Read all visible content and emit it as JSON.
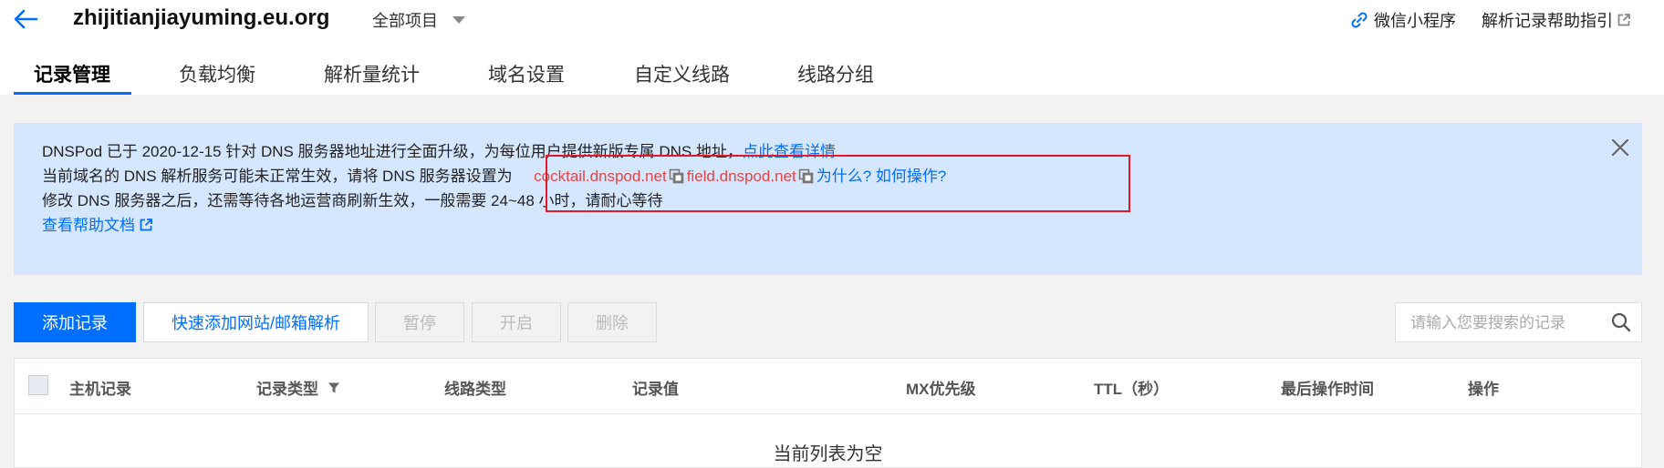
{
  "header": {
    "domain": "zhijitianjiayuming.eu.org",
    "project_select": "全部项目",
    "mini_program": "微信小程序",
    "help_guide": "解析记录帮助指引"
  },
  "tabs": [
    {
      "label": "记录管理",
      "active": true
    },
    {
      "label": "负载均衡"
    },
    {
      "label": "解析量统计"
    },
    {
      "label": "域名设置"
    },
    {
      "label": "自定义线路"
    },
    {
      "label": "线路分组"
    }
  ],
  "notice": {
    "line1_text": "DNSPod 已于 2020-12-15 针对 DNS 服务器地址进行全面升级，为每位用户提供新版专属 DNS 地址，",
    "line1_link": "点此查看详情",
    "line2_prefix": "当前域名的 DNS 解析服务可能未正常生效，请将 DNS 服务器设置为",
    "ns1": "cocktail.dnspod.net",
    "ns2": "field.dnspod.net",
    "line2_link": "为什么? 如何操作?",
    "line3_text": "修改 DNS 服务器之后，还需等待各地运营商刷新生效，一般需要 24~48 小时，请耐心等待",
    "help_doc_link": "查看帮助文档"
  },
  "toolbar": {
    "add_record": "添加记录",
    "quick_add": "快速添加网站/邮箱解析",
    "pause": "暂停",
    "enable": "开启",
    "delete": "删除",
    "search_placeholder": "请输入您要搜索的记录"
  },
  "table": {
    "columns": [
      "主机记录",
      "记录类型",
      "线路类型",
      "记录值",
      "MX优先级",
      "TTL（秒）",
      "最后操作时间",
      "操作"
    ],
    "empty_text": "当前列表为空"
  },
  "colors": {
    "primary": "#006eff",
    "notice_bg": "#d5e7ff",
    "highlight_border": "#e0182a",
    "ns_text": "#e54545"
  },
  "icons": {
    "back": "arrow-left-icon",
    "dropdown": "chevron-down-icon",
    "mini_program": "link-icon",
    "external": "external-link-icon",
    "copy": "copy-icon",
    "close": "close-icon",
    "search": "search-icon",
    "filter": "filter-icon"
  }
}
